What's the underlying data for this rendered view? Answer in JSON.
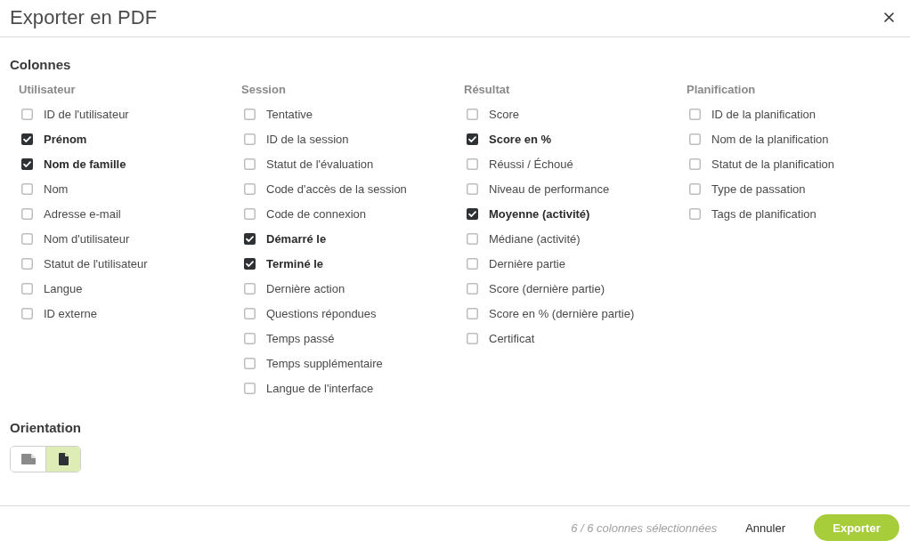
{
  "dialog": {
    "title": "Exporter en PDF"
  },
  "columns_section": {
    "heading": "Colonnes",
    "groups": [
      {
        "heading": "Utilisateur",
        "items": [
          {
            "label": "ID de l'utilisateur",
            "checked": false
          },
          {
            "label": "Prénom",
            "checked": true
          },
          {
            "label": "Nom de famille",
            "checked": true
          },
          {
            "label": "Nom",
            "checked": false
          },
          {
            "label": "Adresse e-mail",
            "checked": false
          },
          {
            "label": "Nom d'utilisateur",
            "checked": false
          },
          {
            "label": "Statut de l'utilisateur",
            "checked": false
          },
          {
            "label": "Langue",
            "checked": false
          },
          {
            "label": "ID externe",
            "checked": false
          }
        ]
      },
      {
        "heading": "Session",
        "items": [
          {
            "label": "Tentative",
            "checked": false
          },
          {
            "label": "ID de la session",
            "checked": false
          },
          {
            "label": "Statut de l'évaluation",
            "checked": false
          },
          {
            "label": "Code d'accès de la session",
            "checked": false
          },
          {
            "label": "Code de connexion",
            "checked": false
          },
          {
            "label": "Démarré le",
            "checked": true
          },
          {
            "label": "Terminé le",
            "checked": true
          },
          {
            "label": "Dernière action",
            "checked": false
          },
          {
            "label": "Questions répondues",
            "checked": false
          },
          {
            "label": "Temps passé",
            "checked": false
          },
          {
            "label": "Temps supplémentaire",
            "checked": false
          },
          {
            "label": "Langue de l'interface",
            "checked": false
          }
        ]
      },
      {
        "heading": "Résultat",
        "items": [
          {
            "label": "Score",
            "checked": false
          },
          {
            "label": "Score en %",
            "checked": true
          },
          {
            "label": "Réussi / Échoué",
            "checked": false
          },
          {
            "label": "Niveau de performance",
            "checked": false
          },
          {
            "label": "Moyenne (activité)",
            "checked": true
          },
          {
            "label": "Médiane (activité)",
            "checked": false
          },
          {
            "label": "Dernière partie",
            "checked": false
          },
          {
            "label": "Score (dernière partie)",
            "checked": false
          },
          {
            "label": "Score en % (dernière partie)",
            "checked": false
          },
          {
            "label": "Certificat",
            "checked": false
          }
        ]
      },
      {
        "heading": "Planification",
        "items": [
          {
            "label": "ID de la planification",
            "checked": false
          },
          {
            "label": "Nom de la planification",
            "checked": false
          },
          {
            "label": "Statut de la planification",
            "checked": false
          },
          {
            "label": "Type de passation",
            "checked": false
          },
          {
            "label": "Tags de planification",
            "checked": false
          }
        ]
      }
    ]
  },
  "orientation": {
    "heading": "Orientation",
    "options": [
      {
        "kind": "landscape",
        "selected": false
      },
      {
        "kind": "portrait",
        "selected": true
      }
    ]
  },
  "footer": {
    "selection_count": "6 / 6 colonnes sélectionnées",
    "buttons": [
      {
        "label": "Annuler",
        "kind": "secondary"
      },
      {
        "label": "Exporter",
        "kind": "primary"
      }
    ]
  }
}
